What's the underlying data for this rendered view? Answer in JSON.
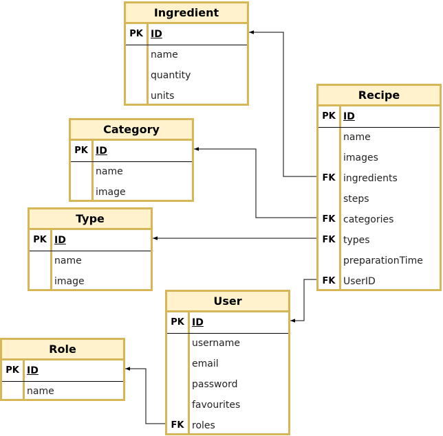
{
  "entities": [
    {
      "id": "ingredient",
      "name": "Ingredient",
      "fields": [
        {
          "key": "PK",
          "name": "ID",
          "pk": true
        },
        {
          "key": "",
          "name": "name"
        },
        {
          "key": "",
          "name": "quantity"
        },
        {
          "key": "",
          "name": "units"
        }
      ]
    },
    {
      "id": "category",
      "name": "Category",
      "fields": [
        {
          "key": "PK",
          "name": "ID",
          "pk": true
        },
        {
          "key": "",
          "name": "name"
        },
        {
          "key": "",
          "name": "image"
        }
      ]
    },
    {
      "id": "type",
      "name": "Type",
      "fields": [
        {
          "key": "PK",
          "name": "ID",
          "pk": true
        },
        {
          "key": "",
          "name": "name"
        },
        {
          "key": "",
          "name": "image"
        }
      ]
    },
    {
      "id": "role",
      "name": "Role",
      "fields": [
        {
          "key": "PK",
          "name": "ID",
          "pk": true
        },
        {
          "key": "",
          "name": "name"
        }
      ]
    },
    {
      "id": "recipe",
      "name": "Recipe",
      "fields": [
        {
          "key": "PK",
          "name": "ID",
          "pk": true
        },
        {
          "key": "",
          "name": "name"
        },
        {
          "key": "",
          "name": "images"
        },
        {
          "key": "FK",
          "name": "ingredients"
        },
        {
          "key": "",
          "name": "steps"
        },
        {
          "key": "FK",
          "name": "categories"
        },
        {
          "key": "FK",
          "name": "types"
        },
        {
          "key": "",
          "name": "preparationTime"
        },
        {
          "key": "FK",
          "name": "UserID"
        }
      ]
    },
    {
      "id": "user",
      "name": "User",
      "fields": [
        {
          "key": "PK",
          "name": "ID",
          "pk": true
        },
        {
          "key": "",
          "name": "username"
        },
        {
          "key": "",
          "name": "email"
        },
        {
          "key": "",
          "name": "password"
        },
        {
          "key": "",
          "name": "favourites"
        },
        {
          "key": "FK",
          "name": "roles"
        }
      ]
    }
  ],
  "relations": [
    {
      "from": "recipe.ingredients",
      "to": "ingredient.ID"
    },
    {
      "from": "recipe.categories",
      "to": "category.ID"
    },
    {
      "from": "recipe.types",
      "to": "type.ID"
    },
    {
      "from": "recipe.UserID",
      "to": "user.ID"
    },
    {
      "from": "user.roles",
      "to": "role.ID"
    }
  ],
  "colors": {
    "border": "#d6b656",
    "header_fill": "#fff2cc",
    "connector": "#000000"
  }
}
